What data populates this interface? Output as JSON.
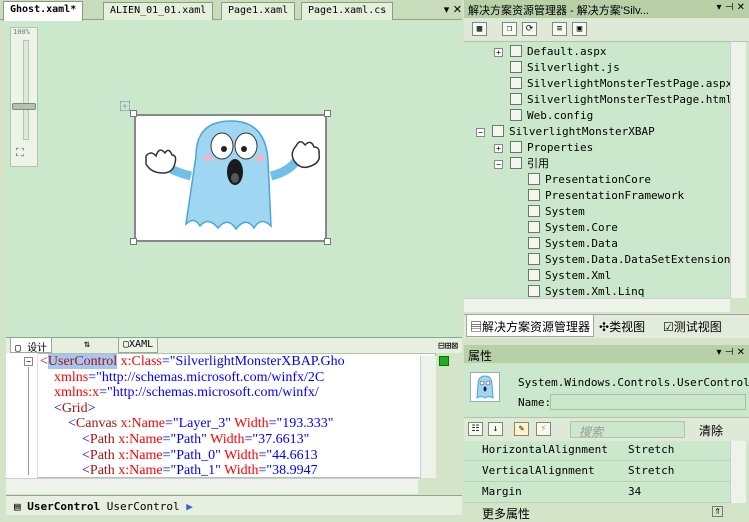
{
  "document_tabs": [
    "Ghost.xaml*",
    "ALIEN_01_01.xaml",
    "Page1.xaml",
    "Page1.xaml.cs"
  ],
  "zoom_label": "100%",
  "view_tabs": {
    "design": "设计",
    "swap": "⇅",
    "xaml": "XAML"
  },
  "code_lines": [
    {
      "parts": [
        [
          "tg",
          "<"
        ],
        [
          "sel",
          "UserControl"
        ],
        [
          "at",
          " x:Class"
        ],
        [
          "bl",
          "=\"SilverlightMonsterXBAP.Gho"
        ]
      ]
    },
    {
      "parts": [
        [
          "at",
          "    xmlns"
        ],
        [
          "bl",
          "=\"http://schemas.microsoft.com/winfx/2C"
        ]
      ]
    },
    {
      "parts": [
        [
          "at",
          "    xmlns:x"
        ],
        [
          "bl",
          "=\"http://schemas.microsoft.com/winfx/"
        ]
      ]
    },
    {
      "parts": [
        [
          "bl",
          "    <"
        ],
        [
          "tg",
          "Grid"
        ],
        [
          "bl",
          ">"
        ]
      ]
    },
    {
      "parts": [
        [
          "bl",
          "        <"
        ],
        [
          "tg",
          "Canvas"
        ],
        [
          "at",
          " x:Name"
        ],
        [
          "bl",
          "=\"Layer_3\""
        ],
        [
          "at",
          " Width"
        ],
        [
          "bl",
          "=\"193.333\""
        ]
      ]
    },
    {
      "parts": [
        [
          "bl",
          "            <"
        ],
        [
          "tg",
          "Path"
        ],
        [
          "at",
          " x:Name"
        ],
        [
          "bl",
          "=\"Path\""
        ],
        [
          "at",
          " Width"
        ],
        [
          "bl",
          "=\"37.6613\""
        ]
      ]
    },
    {
      "parts": [
        [
          "bl",
          "            <"
        ],
        [
          "tg",
          "Path"
        ],
        [
          "at",
          " x:Name"
        ],
        [
          "bl",
          "=\"Path_0\""
        ],
        [
          "at",
          " Width"
        ],
        [
          "bl",
          "=\"44.6613"
        ]
      ]
    },
    {
      "parts": [
        [
          "bl",
          "            <"
        ],
        [
          "tg",
          "Path"
        ],
        [
          "at",
          " x:Name"
        ],
        [
          "bl",
          "=\"Path_1\""
        ],
        [
          "at",
          " Width"
        ],
        [
          "bl",
          "=\"38.9947"
        ]
      ]
    }
  ],
  "breadcrumb": {
    "bold": "UserControl",
    "normal": "UserControl"
  },
  "solution_explorer": {
    "title": "解决方案资源管理器 - 解决方案'Silv...",
    "items": [
      {
        "label": "Default.aspx",
        "indent": 1,
        "exp": "+"
      },
      {
        "label": "Silverlight.js",
        "indent": 1
      },
      {
        "label": "SilverlightMonsterTestPage.aspx",
        "indent": 1
      },
      {
        "label": "SilverlightMonsterTestPage.html",
        "indent": 1
      },
      {
        "label": "Web.config",
        "indent": 1
      },
      {
        "label": "SilverlightMonsterXBAP",
        "indent": 0,
        "exp": "-"
      },
      {
        "label": "Properties",
        "indent": 1,
        "exp": "+"
      },
      {
        "label": "引用",
        "indent": 1,
        "exp": "-"
      },
      {
        "label": "PresentationCore",
        "indent": 2
      },
      {
        "label": "PresentationFramework",
        "indent": 2
      },
      {
        "label": "System",
        "indent": 2
      },
      {
        "label": "System.Core",
        "indent": 2
      },
      {
        "label": "System.Data",
        "indent": 2
      },
      {
        "label": "System.Data.DataSetExtensions",
        "indent": 2
      },
      {
        "label": "System.Xml",
        "indent": 2
      },
      {
        "label": "System.Xml.Linq",
        "indent": 2
      }
    ],
    "bottom_tabs": [
      "解决方案资源管理器",
      "类视图",
      "测试视图"
    ]
  },
  "properties": {
    "title": "属性",
    "type_name": "System.Windows.Controls.UserControl",
    "name_label": "Name:",
    "search_placeholder": "搜索",
    "clear_label": "清除",
    "rows": [
      {
        "name": "HorizontalAlignment",
        "value": "Stretch"
      },
      {
        "name": "VerticalAlignment",
        "value": "Stretch"
      },
      {
        "name": "Margin",
        "value": "34"
      }
    ],
    "more_label": "更多属性"
  },
  "colors": {
    "accent": "#b8d0a8",
    "canvas": "#cce8cc",
    "ghost": "#9fd6f2"
  }
}
